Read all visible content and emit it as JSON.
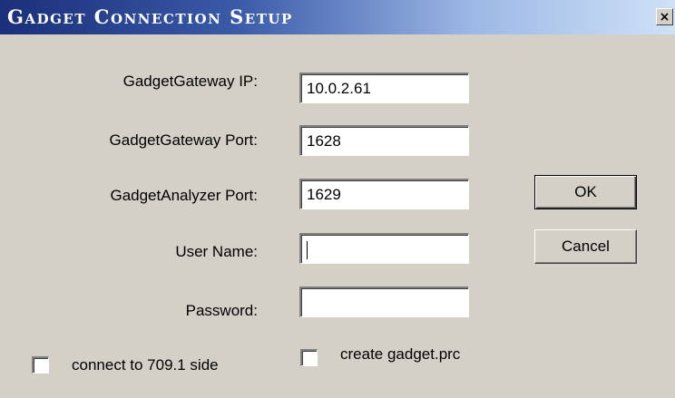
{
  "window": {
    "title": "Gadget Connection Setup",
    "close_glyph": "×"
  },
  "form": {
    "gateway_ip": {
      "label": "GadgetGateway IP:",
      "value": "10.0.2.61"
    },
    "gateway_port": {
      "label": "GadgetGateway Port:",
      "value": "1628"
    },
    "analyzer_port": {
      "label": "GadgetAnalyzer Port:",
      "value": "1629"
    },
    "user_name": {
      "label": "User Name:",
      "value": ""
    },
    "password": {
      "label": "Password:",
      "value": ""
    }
  },
  "buttons": {
    "ok_label": "OK",
    "cancel_label": "Cancel"
  },
  "options": {
    "connect_709": {
      "label": "connect to 709.1 side",
      "checked": false
    },
    "create_prc": {
      "label": "create gadget.prc",
      "checked": false
    }
  },
  "colors": {
    "dialog_bg": "#d4d0c8",
    "title_start": "#1b2f7a",
    "title_end": "#cfe1f7"
  }
}
